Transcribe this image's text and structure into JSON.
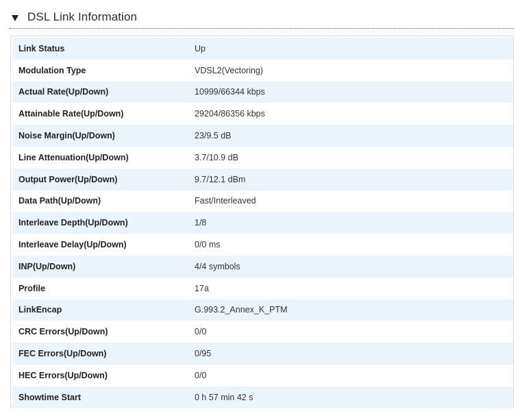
{
  "section": {
    "title": "DSL Link Information"
  },
  "rows": [
    {
      "label": "Link Status",
      "value": "Up"
    },
    {
      "label": "Modulation Type",
      "value": "VDSL2(Vectoring)"
    },
    {
      "label": "Actual Rate(Up/Down)",
      "value": "10999/66344 kbps"
    },
    {
      "label": "Attainable Rate(Up/Down)",
      "value": "29204/86356 kbps"
    },
    {
      "label": "Noise Margin(Up/Down)",
      "value": "23/9.5 dB"
    },
    {
      "label": "Line Attenuation(Up/Down)",
      "value": "3.7/10.9 dB"
    },
    {
      "label": "Output Power(Up/Down)",
      "value": "9.7/12.1 dBm"
    },
    {
      "label": "Data Path(Up/Down)",
      "value": "Fast/Interleaved"
    },
    {
      "label": "Interleave Depth(Up/Down)",
      "value": "1/8"
    },
    {
      "label": "Interleave Delay(Up/Down)",
      "value": "0/0 ms"
    },
    {
      "label": "INP(Up/Down)",
      "value": "4/4 symbols"
    },
    {
      "label": "Profile",
      "value": "17a"
    },
    {
      "label": "LinkEncap",
      "value": "G.993.2_Annex_K_PTM"
    },
    {
      "label": "CRC Errors(Up/Down)",
      "value": "0/0"
    },
    {
      "label": "FEC Errors(Up/Down)",
      "value": "0/95"
    },
    {
      "label": "HEC Errors(Up/Down)",
      "value": "0/0"
    },
    {
      "label": "Showtime Start",
      "value": "0 h 57 min 42 s"
    }
  ]
}
